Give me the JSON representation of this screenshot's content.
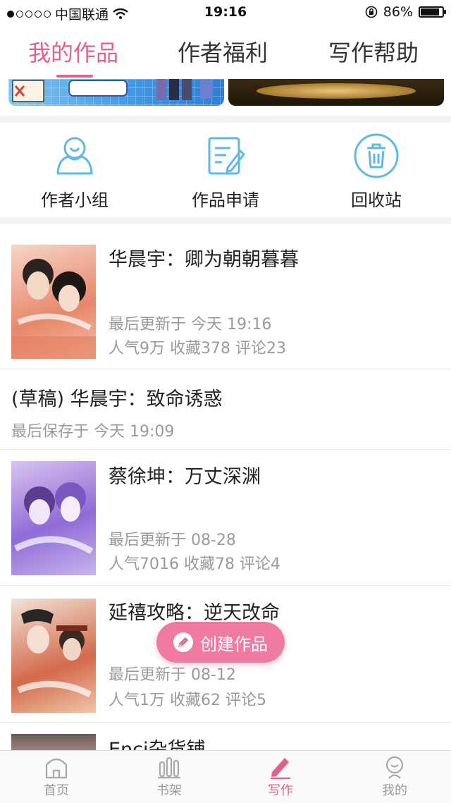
{
  "status_bar": {
    "carrier": "中国联通",
    "time": "19:16",
    "battery": "86%"
  },
  "top_tabs": [
    {
      "label": "我的作品"
    },
    {
      "label": "作者福利"
    },
    {
      "label": "写作帮助"
    }
  ],
  "actions": [
    {
      "label": "作者小组",
      "icon": "group-icon"
    },
    {
      "label": "作品申请",
      "icon": "edit-document-icon"
    },
    {
      "label": "回收站",
      "icon": "trash-icon"
    }
  ],
  "works": [
    {
      "title": "华晨宇：卿为朝朝暮暮",
      "updated": "最后更新于 今天 19:16",
      "stats": "人气9万 收藏378 评论23"
    },
    {
      "title": "(草稿) 华晨宇：致命诱惑",
      "updated": "最后保存于 今天 19:09"
    },
    {
      "title": "蔡徐坤：万丈深渊",
      "updated": "最后更新于 08-28",
      "stats": "人气7016 收藏78 评论4"
    },
    {
      "title": "延禧攻略：逆天改命",
      "updated": "最后更新于 08-12",
      "stats": "人气1万 收藏62 评论5"
    },
    {
      "title": "Enci杂货铺"
    }
  ],
  "fab": {
    "label": "创建作品"
  },
  "bottom_nav": [
    {
      "label": "首页"
    },
    {
      "label": "书架"
    },
    {
      "label": "写作"
    },
    {
      "label": "我的"
    }
  ],
  "colors": {
    "accent": "#e2628a",
    "fab": "#f07aa2",
    "icon_blue": "#5fb8e6",
    "meta_gray": "#9a9a9a"
  }
}
